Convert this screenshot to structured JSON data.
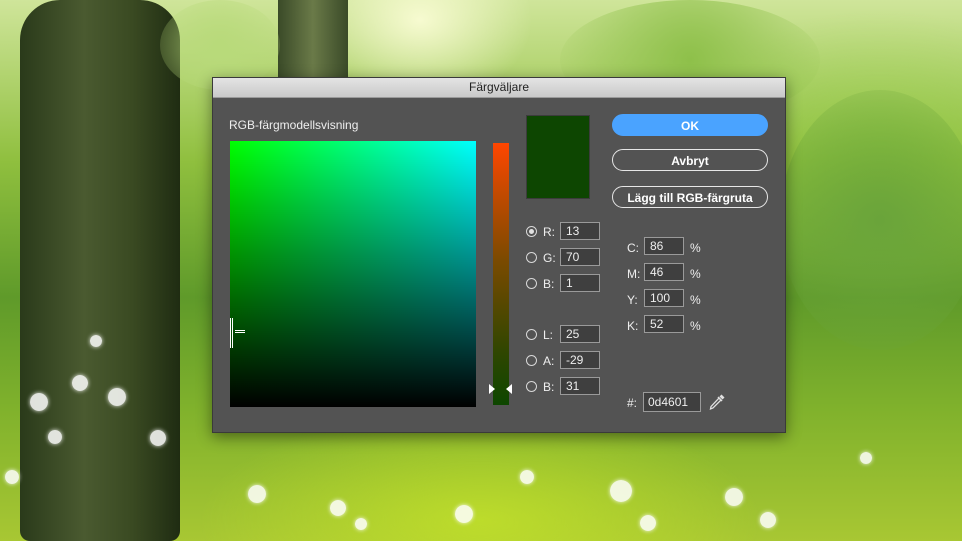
{
  "dialog": {
    "title": "Färgväljare",
    "model_label": "RGB-färgmodellsvisning",
    "buttons": {
      "ok": "OK",
      "cancel": "Avbryt",
      "add_swatch": "Lägg till RGB-färgruta"
    },
    "current_color": "#0d4601",
    "selected_channel": "R"
  },
  "rgb": [
    {
      "label": "R:",
      "value": "13"
    },
    {
      "label": "G:",
      "value": "70"
    },
    {
      "label": "B:",
      "value": "1"
    }
  ],
  "lab": [
    {
      "label": "L:",
      "value": "25"
    },
    {
      "label": "A:",
      "value": "-29"
    },
    {
      "label": "B:",
      "value": "31"
    }
  ],
  "cmyk": [
    {
      "label": "C:",
      "value": "86",
      "unit": "%"
    },
    {
      "label": "M:",
      "value": "46",
      "unit": "%"
    },
    {
      "label": "Y:",
      "value": "100",
      "unit": "%"
    },
    {
      "label": "K:",
      "value": "52",
      "unit": "%"
    }
  ],
  "hex": {
    "label": "#:",
    "value": "0d4601"
  },
  "icons": {
    "eyedropper": "eyedropper-icon"
  }
}
